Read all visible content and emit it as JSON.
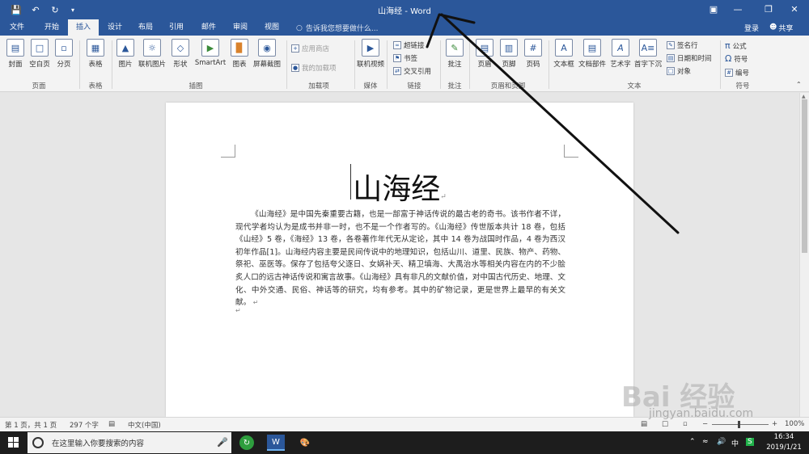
{
  "colors": {
    "word_blue": "#2b579a",
    "ribbon_bg": "#f3f3f3",
    "taskbar": "#1d1d1d"
  },
  "titlebar": {
    "title": "山海经 - Word",
    "save_icon": "save-icon",
    "undo_icon": "undo-icon",
    "redo_icon": "redo-icon"
  },
  "tabs": {
    "file": "文件",
    "home": "开始",
    "insert": "插入",
    "design": "设计",
    "layout": "布局",
    "references": "引用",
    "mailings": "邮件",
    "review": "审阅",
    "view": "视图"
  },
  "tell_me": "告诉我您想要做什么...",
  "account": {
    "login": "登录",
    "share": "共享"
  },
  "ribbon": {
    "pages": {
      "cover": "封面",
      "blank": "空白页",
      "break": "分页",
      "group": "页面"
    },
    "tables": {
      "table": "表格",
      "group": "表格"
    },
    "illustrations": {
      "picture": "图片",
      "online_picture": "联机图片",
      "shapes": "形状",
      "smartart": "SmartArt",
      "chart": "图表",
      "screenshot": "屏幕截图",
      "group": "插图"
    },
    "addins": {
      "store": "应用商店",
      "my_addins": "我的加载项",
      "group": "加载项"
    },
    "media": {
      "online_video": "联机视频",
      "group": "媒体"
    },
    "links": {
      "hyperlink": "超链接",
      "bookmark": "书签",
      "cross_ref": "交叉引用",
      "group": "链接"
    },
    "comments": {
      "comment": "批注",
      "group": "批注"
    },
    "header_footer": {
      "header": "页眉",
      "footer": "页脚",
      "page_number": "页码",
      "group": "页眉和页脚"
    },
    "text": {
      "textbox": "文本框",
      "quickparts": "文档部件",
      "wordart": "艺术字",
      "dropcap": "首字下沉",
      "signature": "签名行",
      "datetime": "日期和时间",
      "object": "对象",
      "group": "文本"
    },
    "symbols": {
      "equation": "公式",
      "symbol": "符号",
      "number": "编号",
      "group": "符号"
    }
  },
  "document": {
    "heading": "山海经",
    "body": "《山海经》是中国先秦重要古籍，也是一部富于神话传说的最古老的奇书。该书作者不详，现代学者均认为是成书并非一时，也不是一个作者写的。《山海经》传世版本共计 18 卷，包括《山经》5 卷，《海经》13 卷，各卷著作年代无从定论，其中 14 卷为战国时作品，4 卷为西汉初年作品[1]。山海经内容主要是民间传说中的地理知识，包括山川、道里、民族、物产、药物、祭祀、巫医等。保存了包括夸父逐日、女娲补天、精卫填海、大禹治水等相关内容在内的不少脍炙人口的远古神话传说和寓言故事。《山海经》具有非凡的文献价值，对中国古代历史、地理、文化、中外交通、民俗、神话等的研究，均有参考。其中的矿物记录，更是世界上最早的有关文献。",
    "return_mark": "↵"
  },
  "status": {
    "page": "第 1 页，共 1 页",
    "words": "297 个字",
    "language": "中文(中国)",
    "zoom": "100%"
  },
  "taskbar": {
    "search_placeholder": "在这里输入你要搜索的内容",
    "time": "16:34",
    "date": "2019/1/21"
  },
  "watermark": {
    "text": "Bai 经验",
    "sub": "jingyan.baidu.com"
  }
}
